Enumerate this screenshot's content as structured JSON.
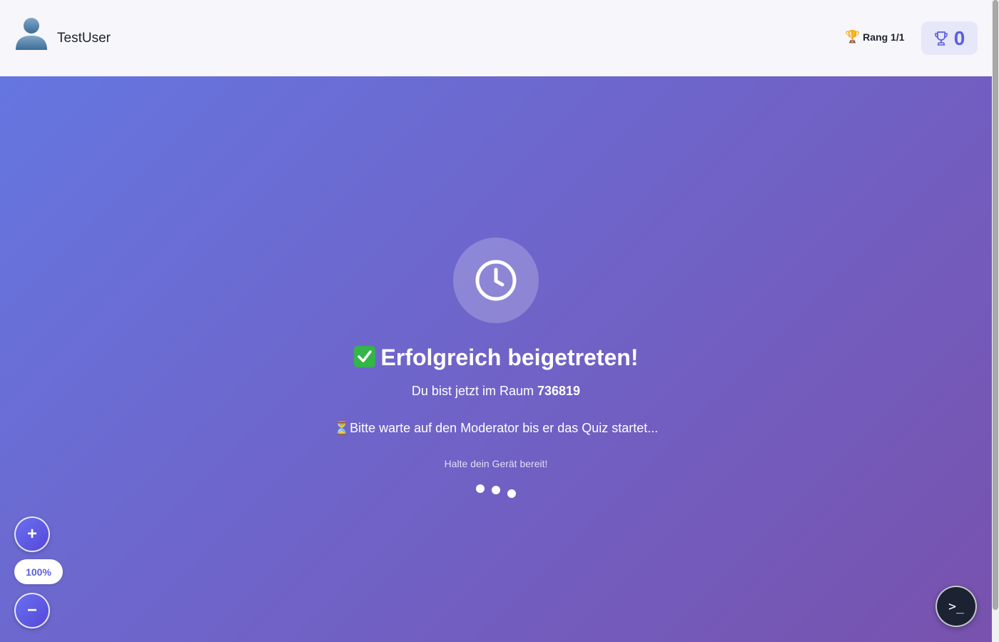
{
  "header": {
    "username": "TestUser",
    "rank_label": "Rang 1/1",
    "rank_icon": "trophy-icon",
    "score": "0",
    "score_icon": "trophy-outline-icon"
  },
  "main": {
    "status_icon": "clock-icon",
    "heading": "Erfolgreich beigetreten!",
    "heading_icon": "check-mark-icon",
    "room_prefix": "Du bist jetzt im Raum",
    "room_code": "736819",
    "wait_message": "⏳Bitte warte auf den Moderator bis er das Quiz startet...",
    "hint": "Halte dein Gerät bereit!",
    "loading_dots": 3
  },
  "zoom": {
    "plus_label": "+",
    "minus_label": "−",
    "level": "100%"
  },
  "terminal": {
    "label": ">_"
  },
  "colors": {
    "accent": "#5a5fe0",
    "gradient_start": "#6576e0",
    "gradient_end": "#7852ad",
    "header_bg": "#f6f6fb",
    "check_green": "#33b54a"
  }
}
